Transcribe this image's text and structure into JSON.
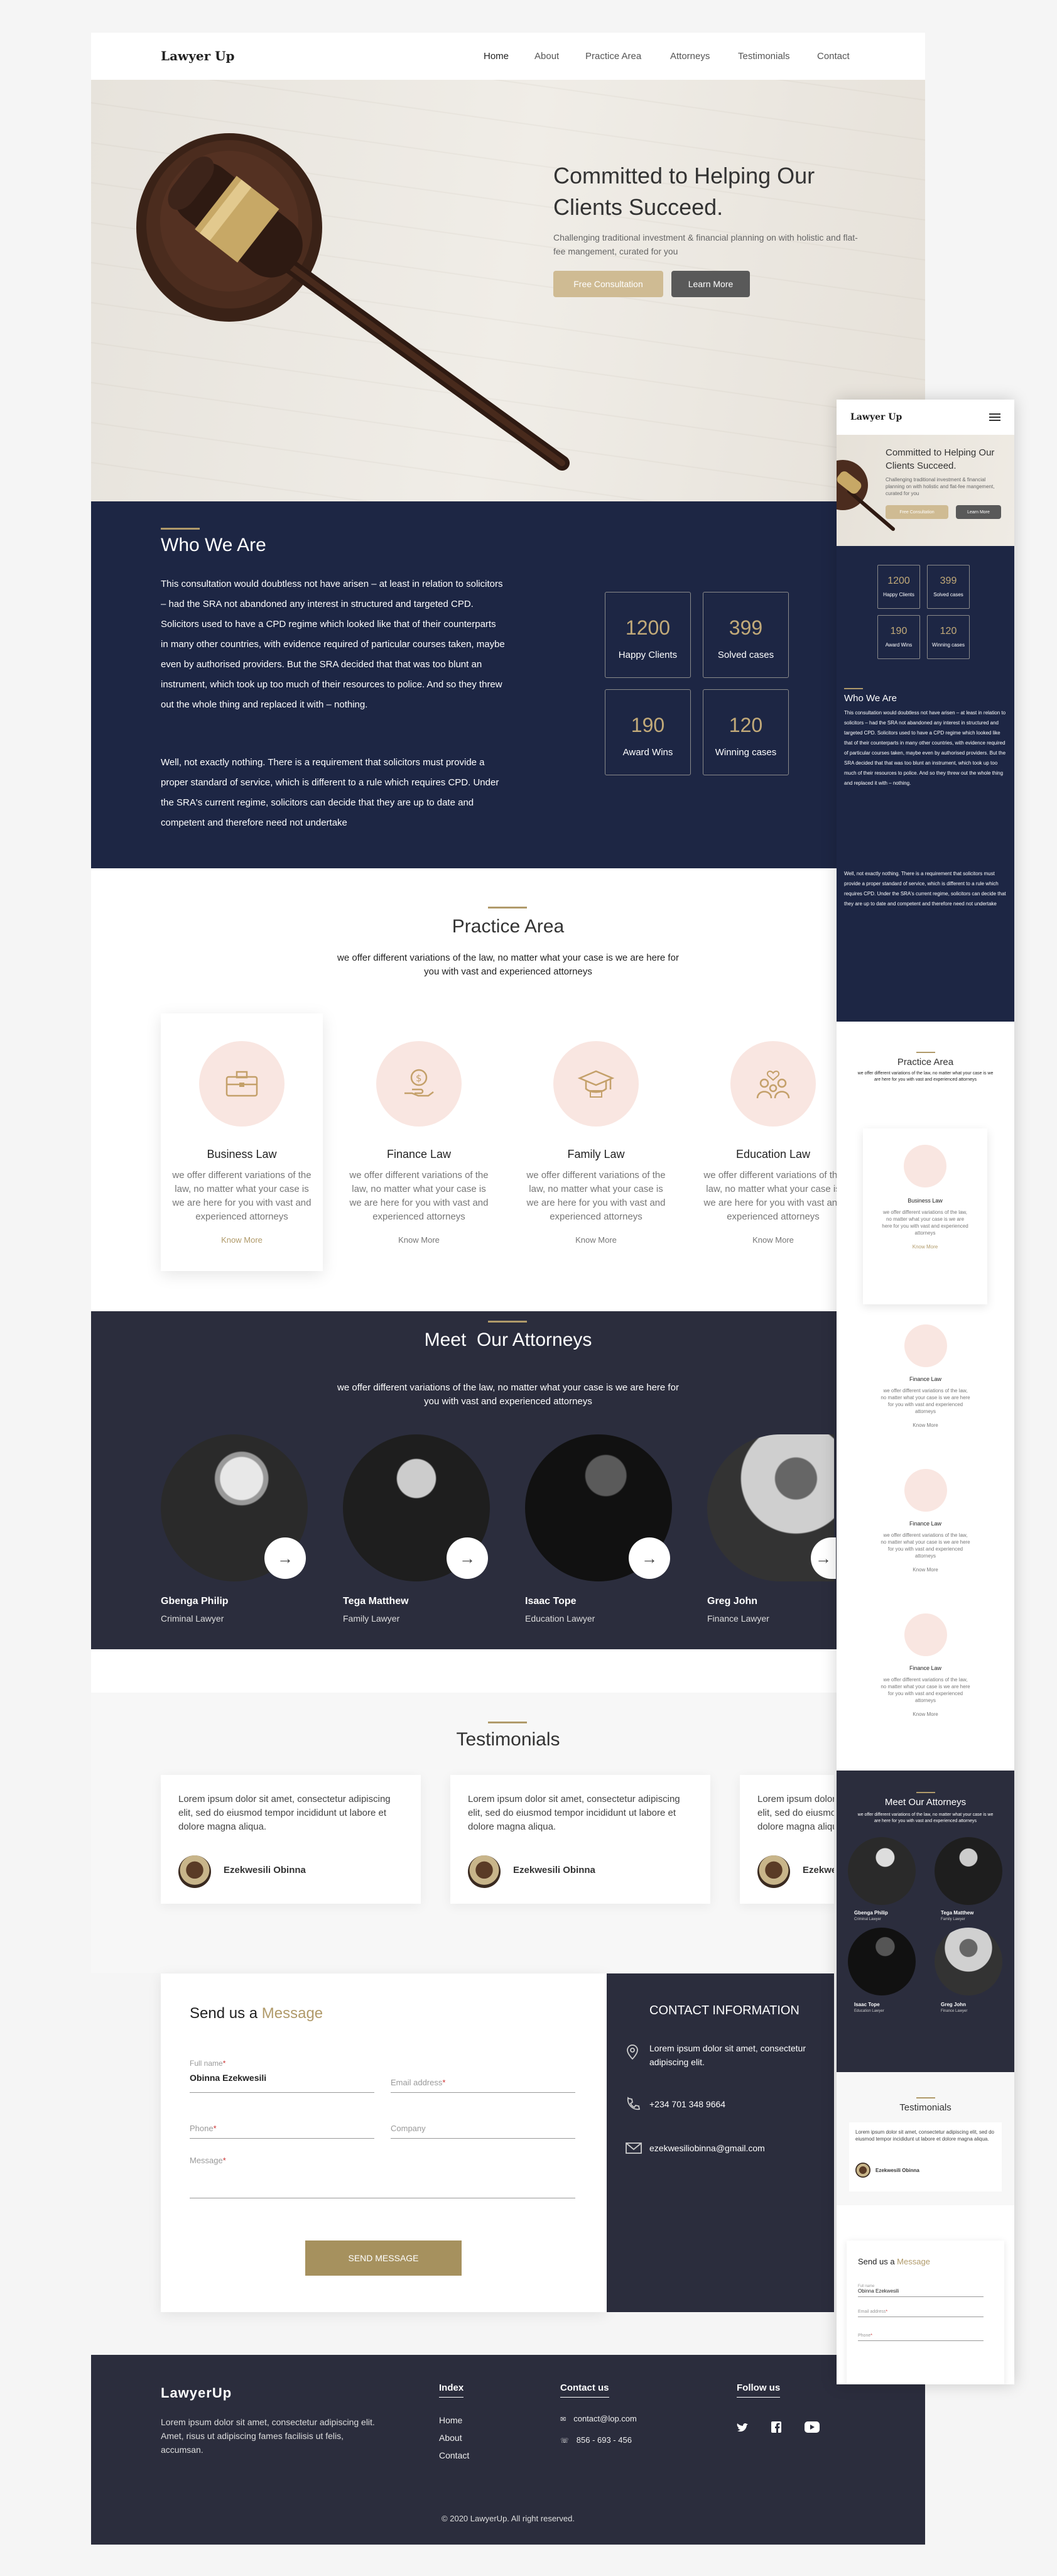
{
  "brand": {
    "logo": "Lawyer Up",
    "footer_logo": "LawyerUp"
  },
  "colors": {
    "accent": "#b09a6a",
    "navy": "#1d2644",
    "dark": "#2b2d3d",
    "pink": "#f9e6e1"
  },
  "nav": {
    "home": "Home",
    "about": "About",
    "practice": "Practice Area",
    "attorneys": "Attorneys",
    "testimonials": "Testimonials",
    "contact": "Contact"
  },
  "hero": {
    "title_line1": "Committed to Helping Our",
    "title_line2": "Clients Succeed.",
    "subtitle": "Challenging traditional investment & financial planning on with holistic and flat-fee mangement, curated for you",
    "btn_primary": "Free Consultation",
    "btn_secondary": "Learn More"
  },
  "who": {
    "title": "Who We Are",
    "para1": "This consultation would doubtless not have arisen – at least in relation to solicitors – had the SRA not abandoned any interest in structured and targeted CPD. Solicitors used to have a CPD regime which looked like that of their counterparts in many other countries, with evidence required of particular courses taken, maybe even by authorised providers. But the SRA decided that that was too blunt an instrument, which took up too much of their resources to police. And so they threw out the whole thing and replaced it with – nothing.",
    "para2": "Well, not exactly nothing. There is a requirement that solicitors must provide a proper standard of service, which is different to a rule which requires CPD. Under the SRA's current regime, solicitors can decide that they are up to date and competent and therefore need not undertake",
    "stats": [
      {
        "num": "1200",
        "label": "Happy Clients"
      },
      {
        "num": "399",
        "label": "Solved cases"
      },
      {
        "num": "190",
        "label": "Award Wins"
      },
      {
        "num": "120",
        "label": "Winning cases"
      }
    ]
  },
  "practice": {
    "title": "Practice Area",
    "subtitle": "we offer different variations of the law, no matter what your case is we are here for you with vast and experienced attorneys",
    "desc": "we offer different variations of the law, no matter what your case is we are here for you with vast and experienced attorneys",
    "more": "Know More",
    "items": [
      {
        "title": "Business Law",
        "icon": "briefcase-icon"
      },
      {
        "title": "Finance Law",
        "icon": "money-hand-icon"
      },
      {
        "title": "Family Law",
        "icon": "graduation-cap-icon"
      },
      {
        "title": "Education Law",
        "icon": "family-icon"
      }
    ]
  },
  "attorneys": {
    "title_a": "Meet",
    "title_b": "Our Attorneys",
    "subtitle": "we offer different variations of the law, no matter what your case is we are here for you with vast and experienced attorneys",
    "people": [
      {
        "name": "Gbenga Philip",
        "role": "Criminal Lawyer"
      },
      {
        "name": "Tega Matthew",
        "role": "Family Lawyer"
      },
      {
        "name": "Isaac Tope",
        "role": "Education Lawyer"
      },
      {
        "name": "Greg John",
        "role": "Finance Lawyer"
      }
    ]
  },
  "testimonials": {
    "title": "Testimonials",
    "quote": "Lorem ipsum dolor sit amet, consectetur adipiscing elit, sed do eiusmod tempor incididunt ut labore et dolore magna aliqua.",
    "author": "Ezekwesili Obinna"
  },
  "form": {
    "title_a": "Send us a",
    "title_b": "Message",
    "name_label": "Full name",
    "name_value": "Obinna Ezekwesili",
    "email_label": "Email address",
    "phone_label": "Phone",
    "company_label": "Company",
    "message_label": "Message",
    "submit": "SEND MESSAGE",
    "required": "*"
  },
  "contact": {
    "title": "CONTACT INFORMATION",
    "address": "Lorem ipsum dolor sit amet, consectetur adipiscing elit.",
    "phone": "+234 701 348 9664",
    "email": "ezekwesiliobinna@gmail.com"
  },
  "footer": {
    "about": "Lorem ipsum dolor sit amet, consectetur adipiscing elit. Amet, risus ut adipiscing fames facilisis ut felis, accumsan.",
    "index_title": "Index",
    "index_items": [
      "Home",
      "About",
      "Contact"
    ],
    "contact_title": "Contact us",
    "contact_email": "contact@lop.com",
    "contact_phone": "856 - 693 - 456",
    "follow_title": "Follow us",
    "social": [
      "twitter-icon",
      "facebook-icon",
      "youtube-icon"
    ],
    "copyright": "© 2020 LawyerUp. All right reserved."
  },
  "mobile": {
    "logo": "Lawyer Up",
    "hero_title": "Committed to Helping Our Clients Succeed.",
    "hero_sub": "Challenging traditional investment & financial planning on with holistic and flat-fee mangement, curated for you",
    "btn_primary": "Free Consultation",
    "btn_secondary": "Learn More",
    "who_title": "Who We Are",
    "practice_titles": [
      "Business Law",
      "Finance Law",
      "Finance Law",
      "Finance Law"
    ],
    "attorney_title": "Meet  Our Attorneys"
  }
}
